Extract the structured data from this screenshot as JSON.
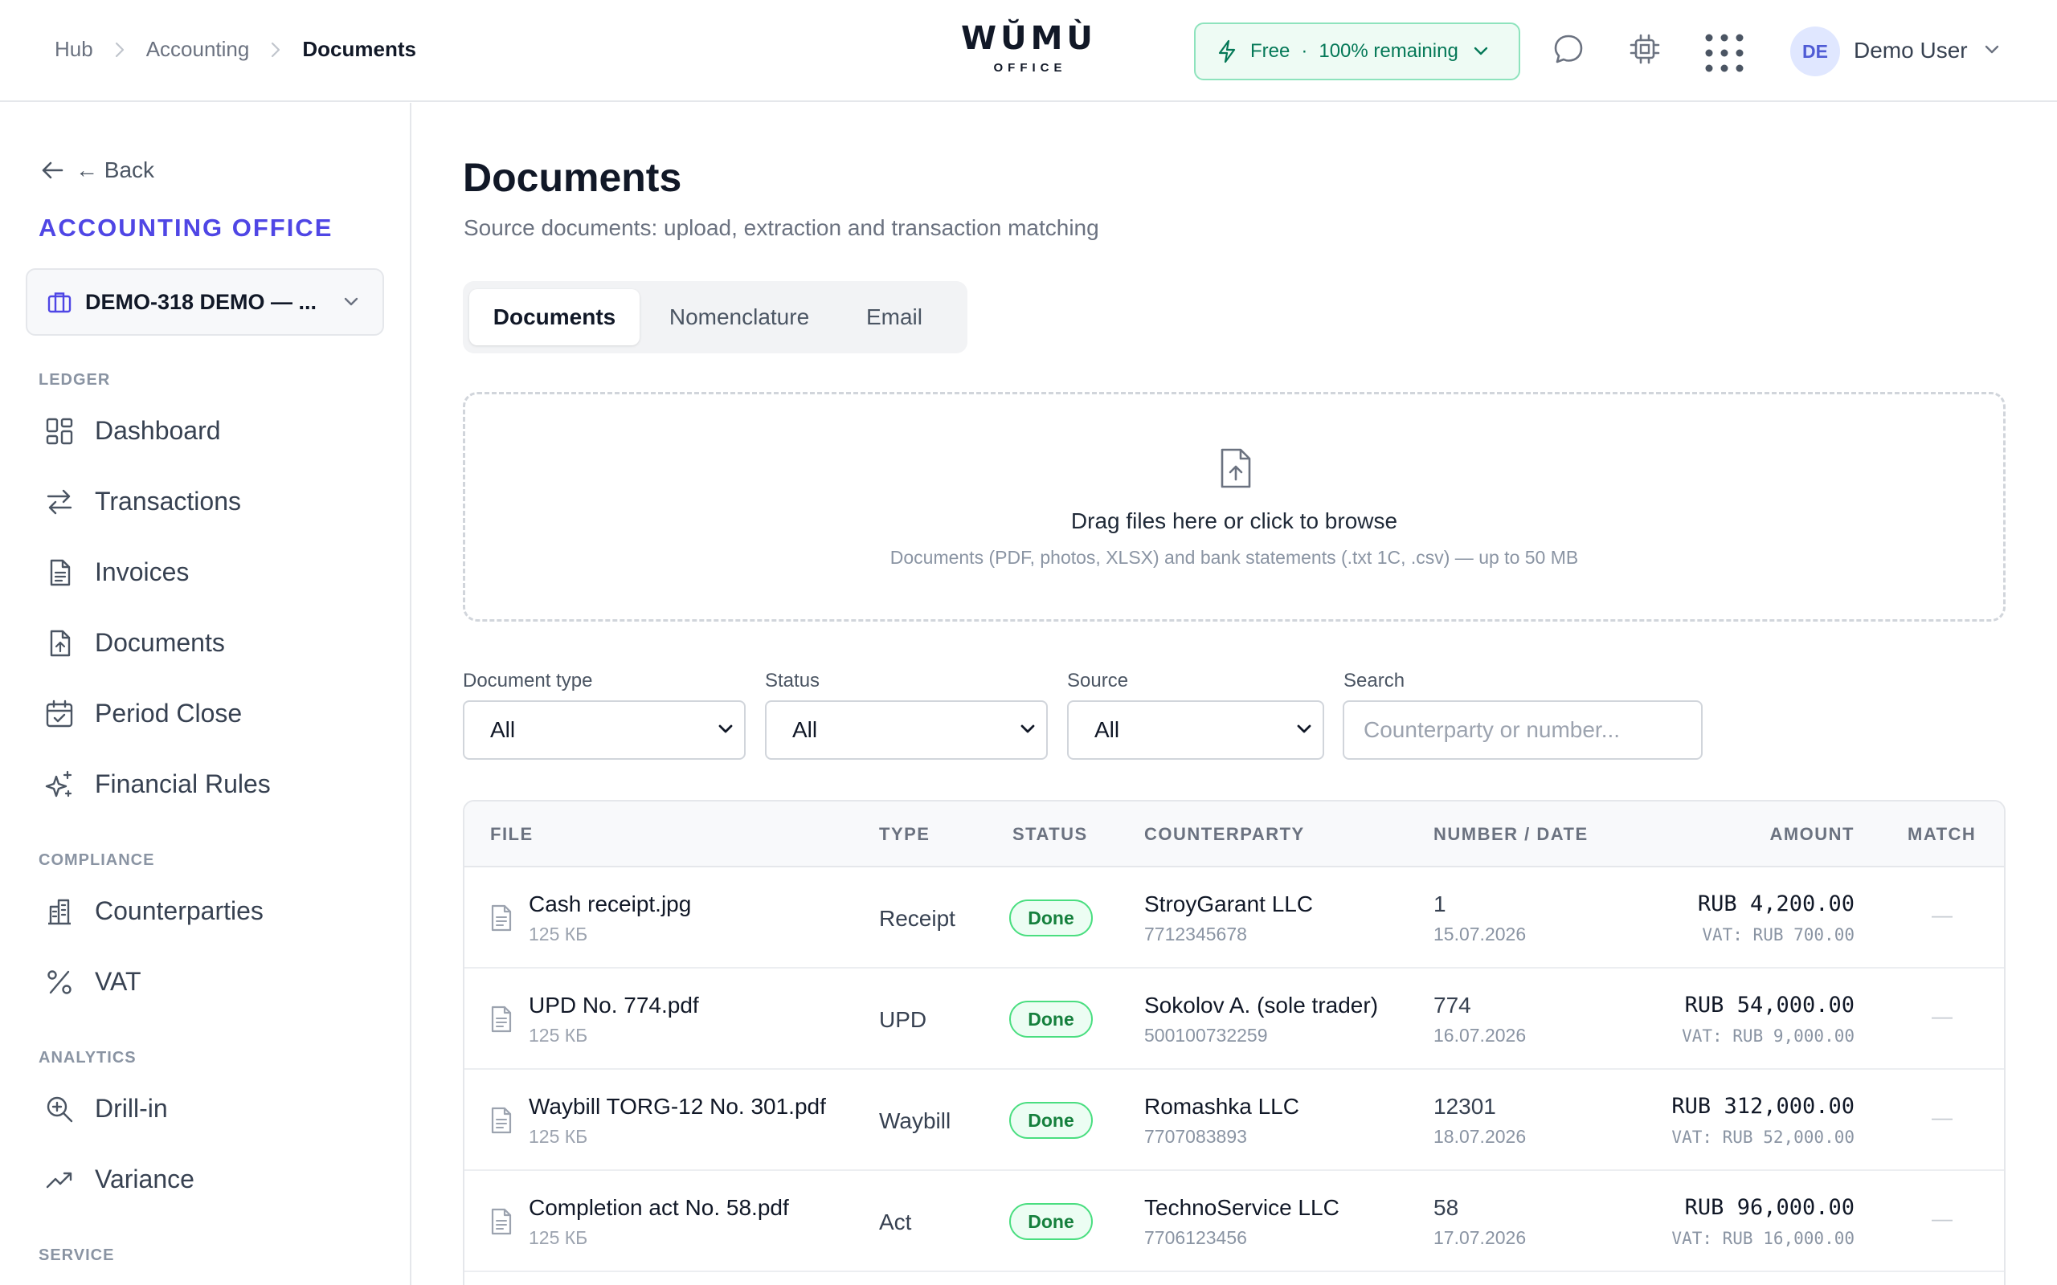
{
  "breadcrumb": [
    "Hub",
    "Accounting",
    "Documents"
  ],
  "logo": {
    "main": "WŬMÙ",
    "sub": "OFFICE"
  },
  "plan": {
    "name": "Free",
    "separator": "·",
    "remaining": "100% remaining"
  },
  "user": {
    "initials": "DE",
    "name": "Demo User"
  },
  "sidebar": {
    "back_label": "← Back",
    "brand": "ACCOUNTING OFFICE",
    "company": "DEMO-318 DEMO — ...",
    "sections": {
      "ledger": "LEDGER",
      "compliance": "COMPLIANCE",
      "analytics": "ANALYTICS",
      "service": "SERVICE"
    },
    "items": {
      "dashboard": "Dashboard",
      "transactions": "Transactions",
      "invoices": "Invoices",
      "documents": "Documents",
      "period_close": "Period Close",
      "financial_rules": "Financial Rules",
      "counterparties": "Counterparties",
      "vat": "VAT",
      "drill_in": "Drill-in",
      "variance": "Variance"
    }
  },
  "page": {
    "title": "Documents",
    "subtitle": "Source documents: upload, extraction and transaction matching"
  },
  "tabs": [
    "Documents",
    "Nomenclature",
    "Email"
  ],
  "upload": {
    "title": "Drag files here or click to browse",
    "hint": "Documents (PDF, photos, XLSX) and bank statements (.txt 1C, .csv) — up to 50 MB"
  },
  "filters": {
    "doc_type": {
      "label": "Document type",
      "value": "All"
    },
    "status": {
      "label": "Status",
      "value": "All"
    },
    "source": {
      "label": "Source",
      "value": "All"
    },
    "search": {
      "label": "Search",
      "placeholder": "Counterparty or number..."
    }
  },
  "table": {
    "columns": {
      "file": "FILE",
      "type": "TYPE",
      "status": "STATUS",
      "counterparty": "COUNTERPARTY",
      "number_date": "NUMBER / DATE",
      "amount": "AMOUNT",
      "match": "MATCH"
    },
    "rows": [
      {
        "file": "Cash receipt.jpg",
        "size": "125 КБ",
        "type": "Receipt",
        "status": "Done",
        "counterparty": "StroyGarant LLC",
        "inn": "7712345678",
        "number": "1",
        "date": "15.07.2026",
        "amount": "RUB 4,200.00",
        "vat": "VAT: RUB 700.00",
        "match": "—"
      },
      {
        "file": "UPD No. 774.pdf",
        "size": "125 КБ",
        "type": "UPD",
        "status": "Done",
        "counterparty": "Sokolov A. (sole trader)",
        "inn": "500100732259",
        "number": "774",
        "date": "16.07.2026",
        "amount": "RUB 54,000.00",
        "vat": "VAT: RUB 9,000.00",
        "match": "—"
      },
      {
        "file": "Waybill TORG-12 No. 301.pdf",
        "size": "125 КБ",
        "type": "Waybill",
        "status": "Done",
        "counterparty": "Romashka LLC",
        "inn": "7707083893",
        "number": "12301",
        "date": "18.07.2026",
        "amount": "RUB 312,000.00",
        "vat": "VAT: RUB 52,000.00",
        "match": "—"
      },
      {
        "file": "Completion act No. 58.pdf",
        "size": "125 КБ",
        "type": "Act",
        "status": "Done",
        "counterparty": "TechnoService LLC",
        "inn": "7706123456",
        "number": "58",
        "date": "17.07.2026",
        "amount": "RUB 96,000.00",
        "vat": "VAT: RUB 16,000.00",
        "match": "—"
      }
    ]
  },
  "colors": {
    "accent": "#4f46e5",
    "success": "#15803d",
    "plan_bg": "#eefbf4"
  }
}
